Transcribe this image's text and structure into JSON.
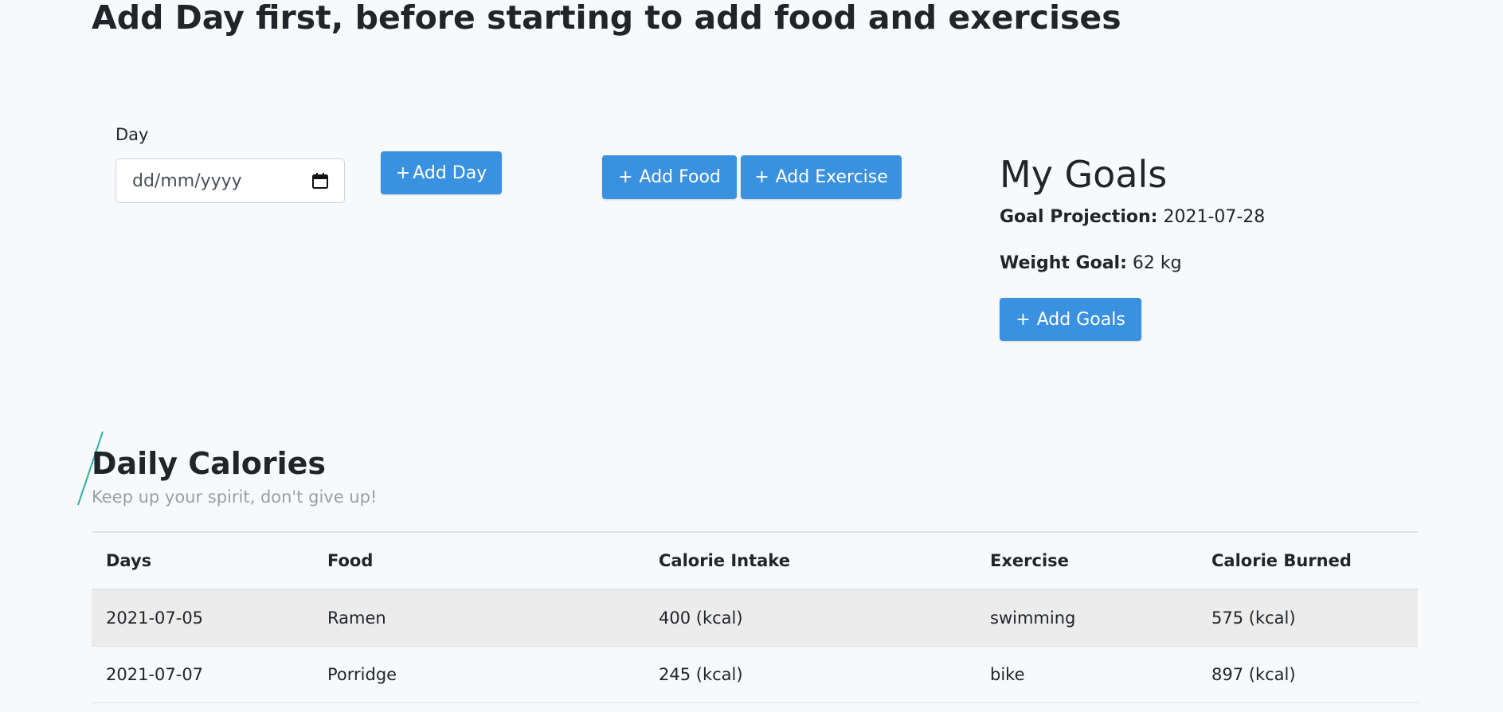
{
  "header": {
    "headline": "Add Day first, before starting to add food and exercises"
  },
  "day_form": {
    "label": "Day",
    "date_placeholder": "dd/mm/yyyy",
    "add_day_plus": "+",
    "add_day_label": "Add Day"
  },
  "actions": {
    "add_food_plus": "+",
    "add_food_label": "Add Food",
    "add_exercise_plus": "+",
    "add_exercise_label": "Add Exercise"
  },
  "goals": {
    "title": "My Goals",
    "projection_label": "Goal Projection:",
    "projection_value": "2021-07-28",
    "weight_label": "Weight Goal:",
    "weight_value": "62 kg",
    "add_goals_plus": "+",
    "add_goals_label": "Add Goals"
  },
  "daily_calories": {
    "title": "Daily Calories",
    "subtitle": "Keep up your spirit, don't give up!",
    "columns": [
      "Days",
      "Food",
      "Calorie Intake",
      "Exercise",
      "Calorie Burned"
    ],
    "rows": [
      [
        "2021-07-05",
        "Ramen",
        "400 (kcal)",
        "swimming",
        "575 (kcal)"
      ],
      [
        "2021-07-07",
        "Porridge",
        "245 (kcal)",
        "bike",
        "897 (kcal)"
      ]
    ]
  },
  "colors": {
    "button_blue": "#3a91e0",
    "accent_teal": "#2bb59a",
    "background": "#f8f9fa",
    "striped_row": "#ececed"
  },
  "icons": {
    "date_picker": "calendar-icon",
    "section_accent": "slash-accent"
  }
}
